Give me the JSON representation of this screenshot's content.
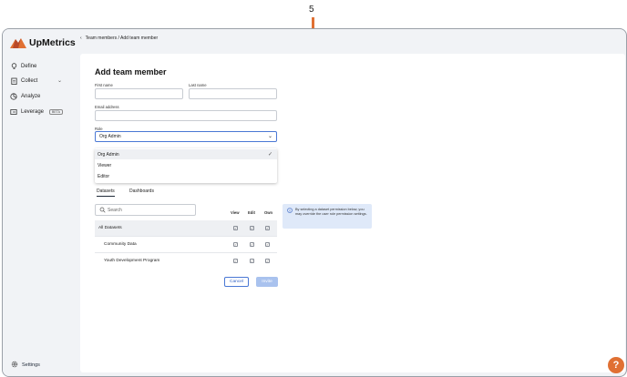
{
  "annotation": {
    "number": "5"
  },
  "brand": {
    "name": "UpMetrics",
    "accent": "#e07033"
  },
  "sidebar": {
    "items": [
      {
        "label": "Define",
        "icon": "lightbulb-icon"
      },
      {
        "label": "Collect",
        "icon": "clipboard-icon"
      },
      {
        "label": "Analyze",
        "icon": "pie-chart-icon"
      },
      {
        "label": "Leverage",
        "icon": "share-icon",
        "badge": "BETA"
      }
    ],
    "settings_label": "Settings"
  },
  "breadcrumb": {
    "text": "Team members / Add team member"
  },
  "form": {
    "title": "Add team member",
    "first_name_label": "First name",
    "last_name_label": "Last name",
    "email_label": "Email address",
    "role_label": "Role",
    "role_value": "Org Admin",
    "role_options": [
      "Org Admin",
      "Viewer",
      "Editor"
    ]
  },
  "tabs": [
    "Datasets",
    "Dashboards"
  ],
  "search": {
    "placeholder": "Search"
  },
  "columns": [
    "View",
    "Edit",
    "Own"
  ],
  "rows": [
    {
      "label": "All Datasets"
    },
    {
      "label": "Community Data"
    },
    {
      "label": "Youth Development Program"
    }
  ],
  "info_text": "By selecting a dataset permission below, you may override the user role permission settings.",
  "buttons": {
    "cancel": "Cancel",
    "invite": "Invite"
  },
  "help_label": "?"
}
